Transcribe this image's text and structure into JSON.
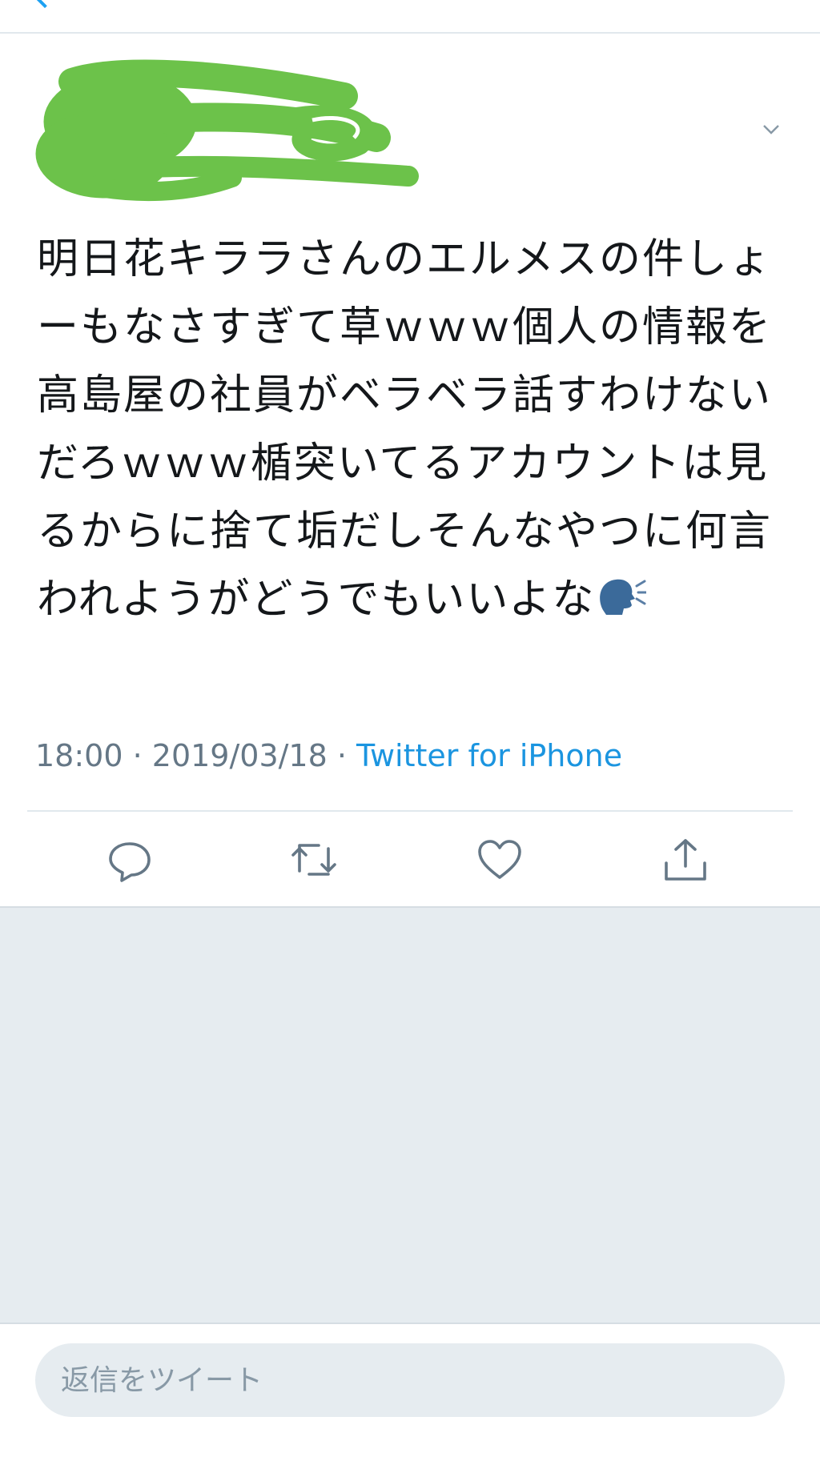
{
  "author": {
    "redacted": true,
    "redaction_color": "#6cc24a",
    "menu_icon": "chevron-down-icon"
  },
  "tweet": {
    "text": "明日花キララさんのエルメスの件しょーもなさすぎて草ｗｗｗ個人の情報を高島屋の社員がベラベラ話すわけないだろｗｗｗ楯突いてるアカウントは見るからに捨て垢だしそんなやつに何言われようがどうでもいいよな",
    "emoji": "speaking-head-icon",
    "time": "18:00",
    "separator": " · ",
    "date": "2019/03/18",
    "source": "Twitter for iPhone"
  },
  "actions": [
    {
      "name": "reply",
      "icon": "reply-icon"
    },
    {
      "name": "retweet",
      "icon": "retweet-icon"
    },
    {
      "name": "like",
      "icon": "heart-icon"
    },
    {
      "name": "share",
      "icon": "share-icon"
    }
  ],
  "reply_bar": {
    "placeholder": "返信をツイート"
  },
  "colors": {
    "accent": "#1da1f2",
    "source_link": "#1b95e0",
    "meta_text": "#657786",
    "feed_background": "#e6ecf0"
  }
}
